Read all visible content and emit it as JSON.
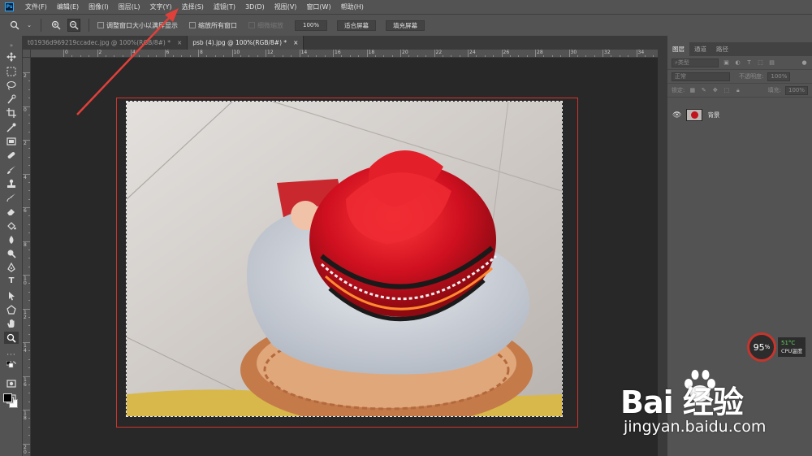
{
  "app": {
    "logo_text": "Ps"
  },
  "menu": [
    "文件(F)",
    "编辑(E)",
    "图像(I)",
    "图层(L)",
    "文字(Y)",
    "选择(S)",
    "滤镜(T)",
    "3D(D)",
    "视图(V)",
    "窗口(W)",
    "帮助(H)"
  ],
  "options": {
    "tool_icon": "zoom-icon",
    "resize_windows": "调整窗口大小以满屏显示",
    "zoom_all_windows": "缩放所有窗口",
    "scrubby_zoom": "细微缩放",
    "zoom_value": "100%",
    "fit_screen": "适合屏幕",
    "fill_screen": "填充屏幕"
  },
  "tabs": [
    {
      "label": "t01936d969219ccadec.jpg @ 100%(RGB/8#) *",
      "active": false
    },
    {
      "label": "psb (4).jpg @ 100%(RGB/8#) *",
      "active": true
    }
  ],
  "ruler_top": [
    "0",
    "2",
    "4",
    "6",
    "8",
    "10",
    "12",
    "14",
    "16",
    "18",
    "20",
    "22",
    "24",
    "26",
    "28",
    "30",
    "32",
    "34"
  ],
  "ruler_left": [
    "2",
    "0",
    "2",
    "4",
    "6",
    "8",
    "1\n0",
    "1\n2",
    "1\n4",
    "1\n6",
    "1\n8",
    "2\n0"
  ],
  "layers_panel": {
    "tabs": [
      "图层",
      "通道",
      "路径"
    ],
    "filter_label": "类型",
    "blend_mode": "正常",
    "opacity_label": "不透明度:",
    "opacity_value": "100%",
    "lock_label": "锁定:",
    "fill_label": "填充:",
    "fill_value": "100%",
    "layer_name": "背景"
  },
  "cpu_widget": {
    "usage": "95",
    "usage_unit": "%",
    "temp": "51°C",
    "label": "CPU温度"
  },
  "watermark": {
    "brand": "Bai  经验",
    "url": "jingyan.baidu.com"
  },
  "colors": {
    "accent_red": "#d0342c",
    "arrow_red": "#e0403a",
    "ui_gray": "#535353",
    "canvas_bg": "#282828"
  }
}
